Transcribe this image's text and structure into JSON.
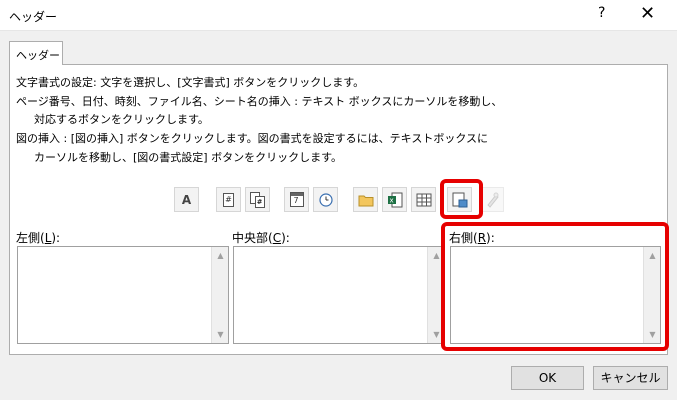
{
  "window": {
    "title": "ヘッダー",
    "help": "?",
    "close": "✕"
  },
  "tab": {
    "label": "ヘッダー"
  },
  "instructions": [
    "文字書式の設定: 文字を選択し、[文字書式] ボタンをクリックします。",
    "ページ番号、日付、時刻、ファイル名、シート名の挿入 : テキスト ボックスにカーソルを移動し、",
    "対応するボタンをクリックします。",
    "図の挿入 : [図の挿入] ボタンをクリックします。図の書式を設定するには、テキストボックスに",
    "カーソルを移動し、[図の書式設定] ボタンをクリックします。"
  ],
  "toolbar": {
    "format_text_glyph": "A",
    "page_number_glyph": "#",
    "date_glyph": "7"
  },
  "sections": {
    "left": {
      "label_pre": "左側(",
      "accel": "L",
      "label_post": "):"
    },
    "center": {
      "label_pre": "中央部(",
      "accel": "C",
      "label_post": "):"
    },
    "right": {
      "label_pre": "右側(",
      "accel": "R",
      "label_post": "):"
    }
  },
  "buttons": {
    "ok": "OK",
    "cancel": "キャンセル"
  },
  "colors": {
    "highlight": "#e60000"
  }
}
